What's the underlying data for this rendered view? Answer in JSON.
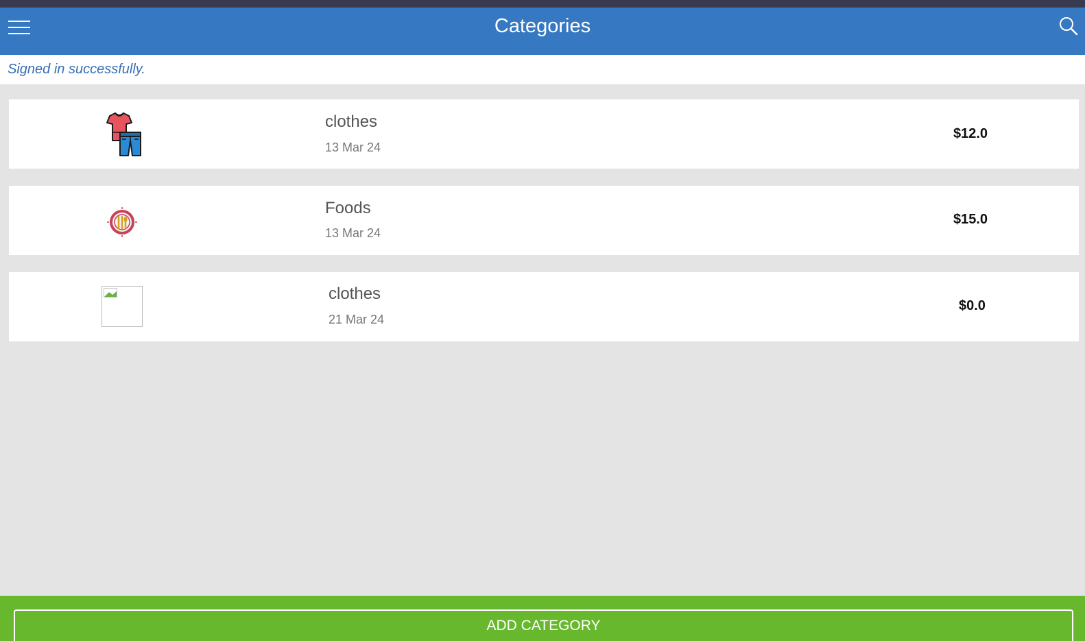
{
  "header": {
    "title": "Categories",
    "menu_icon": "hamburger-menu-icon",
    "search_icon": "search-icon"
  },
  "notice": {
    "text": "Signed in successfully."
  },
  "categories": [
    {
      "name": "clothes",
      "date": "13 Mar 24",
      "amount": "$12.0",
      "icon": "clothes-icon"
    },
    {
      "name": "Foods",
      "date": "13 Mar 24",
      "amount": "$15.0",
      "icon": "food-plate-icon"
    },
    {
      "name": "clothes",
      "date": "21 Mar 24",
      "amount": "$0.0",
      "icon": "broken-image-icon"
    }
  ],
  "footer": {
    "add_label": "ADD CATEGORY"
  },
  "colors": {
    "header_bg": "#3778c3",
    "footer_bg": "#68b82e",
    "notice_text": "#3670b5"
  }
}
